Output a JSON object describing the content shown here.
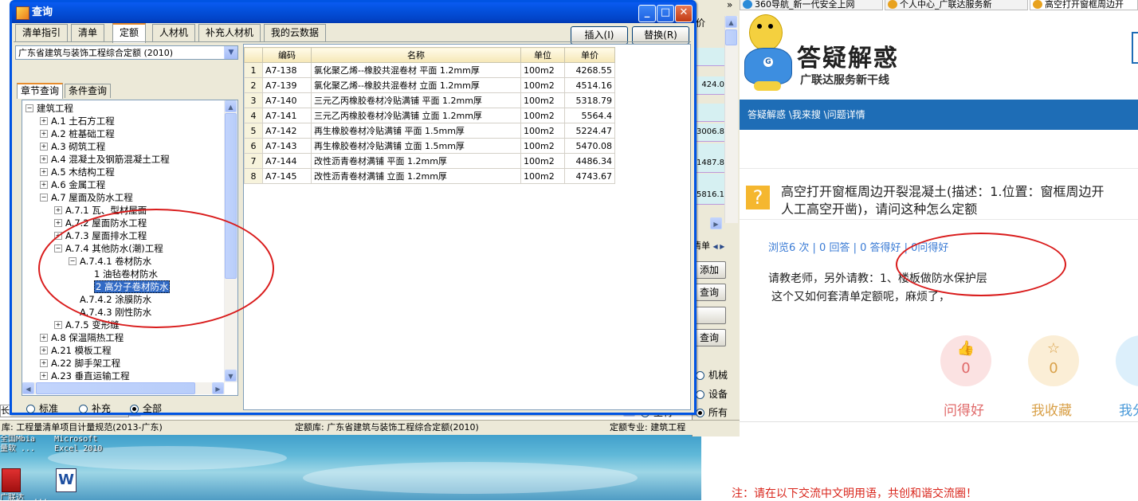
{
  "dialog": {
    "title": "查询",
    "tabs": [
      "清单指引",
      "清单",
      "定额",
      "人材机",
      "补充人材机",
      "我的云数据"
    ],
    "selected_tab": "定额",
    "insert_button": "插入(I)",
    "replace_button": "替换(R)",
    "library_combo": "广东省建筑与装饰工程综合定额 (2010)",
    "subtabs": [
      "章节查询",
      "条件查询"
    ],
    "tree": [
      {
        "label": "建筑工程",
        "pm": "−",
        "indent": 0
      },
      {
        "label": "A.1 土石方工程",
        "pm": "+",
        "indent": 1
      },
      {
        "label": "A.2 桩基础工程",
        "pm": "+",
        "indent": 1
      },
      {
        "label": "A.3 砌筑工程",
        "pm": "+",
        "indent": 1
      },
      {
        "label": "A.4 混凝土及钢筋混凝土工程",
        "pm": "+",
        "indent": 1
      },
      {
        "label": "A.5 木结构工程",
        "pm": "+",
        "indent": 1
      },
      {
        "label": "A.6 金属工程",
        "pm": "+",
        "indent": 1
      },
      {
        "label": "A.7 屋面及防水工程",
        "pm": "−",
        "indent": 1
      },
      {
        "label": "A.7.1 瓦、型材屋面",
        "pm": "+",
        "indent": 2
      },
      {
        "label": "A.7.2 屋面防水工程",
        "pm": "+",
        "indent": 2
      },
      {
        "label": "A.7.3 屋面排水工程",
        "pm": "+",
        "indent": 2
      },
      {
        "label": "A.7.4 其他防水(潮)工程",
        "pm": "−",
        "indent": 2
      },
      {
        "label": "A.7.4.1 卷材防水",
        "pm": "−",
        "indent": 3
      },
      {
        "label": "1 油毡卷材防水",
        "pm": "",
        "indent": 4
      },
      {
        "label": "2 高分子卷材防水",
        "pm": "",
        "indent": 4,
        "selected": true
      },
      {
        "label": "A.7.4.2 涂膜防水",
        "pm": "",
        "indent": 3
      },
      {
        "label": "A.7.4.3 刚性防水",
        "pm": "",
        "indent": 3
      },
      {
        "label": "A.7.5 变形缝",
        "pm": "+",
        "indent": 2
      },
      {
        "label": "A.8 保温隔热工程",
        "pm": "+",
        "indent": 1
      },
      {
        "label": "A.21 模板工程",
        "pm": "+",
        "indent": 1
      },
      {
        "label": "A.22 脚手架工程",
        "pm": "+",
        "indent": 1
      },
      {
        "label": "A.23 垂直运输工程",
        "pm": "+",
        "indent": 1
      }
    ],
    "radios": [
      {
        "label": "标准",
        "checked": false
      },
      {
        "label": "补充",
        "checked": false
      },
      {
        "label": "全部",
        "checked": true
      }
    ],
    "table": {
      "headers": [
        "编码",
        "名称",
        "单位",
        "单价"
      ],
      "rows": [
        {
          "n": "1",
          "code": "A7-138",
          "name": "氯化聚乙烯--橡胶共混卷材 平面 1.2mm厚",
          "unit": "100m2",
          "price": "4268.55"
        },
        {
          "n": "2",
          "code": "A7-139",
          "name": "氯化聚乙烯--橡胶共混卷材 立面 1.2mm厚",
          "unit": "100m2",
          "price": "4514.16"
        },
        {
          "n": "3",
          "code": "A7-140",
          "name": "三元乙丙橡胶卷材冷贴满铺 平面 1.2mm厚",
          "unit": "100m2",
          "price": "5318.79"
        },
        {
          "n": "4",
          "code": "A7-141",
          "name": "三元乙丙橡胶卷材冷贴满铺 立面 1.2mm厚",
          "unit": "100m2",
          "price": "5564.4"
        },
        {
          "n": "5",
          "code": "A7-142",
          "name": "再生橡胶卷材冷贴满铺 平面 1.5mm厚",
          "unit": "100m2",
          "price": "5224.47"
        },
        {
          "n": "6",
          "code": "A7-143",
          "name": "再生橡胶卷材冷贴满铺 立面 1.5mm厚",
          "unit": "100m2",
          "price": "5470.08"
        },
        {
          "n": "7",
          "code": "A7-144",
          "name": "改性沥青卷材满铺 平面 1.2mm厚",
          "unit": "100m2",
          "price": "4486.34"
        },
        {
          "n": "8",
          "code": "A7-145",
          "name": "改性沥青卷材满铺 立面 1.2mm厚",
          "unit": "100m2",
          "price": "4743.67"
        }
      ]
    }
  },
  "background_app": {
    "col_header": "价",
    "values": [
      "424.0",
      "3006.8",
      "1487.8",
      "5816.1"
    ],
    "panel_label": "清单",
    "add_button": "添加",
    "query_button_1": "查询",
    "query_button_2": "查询",
    "radio_machine": "机械",
    "radio_equipment": "设备",
    "radio_all": "所有",
    "radio_main": "主材",
    "left_fragment": "长城大(万台网)"
  },
  "status_bar": {
    "left": "库: 工程量清单项目计量规范(2013-广东)",
    "middle": "定额库: 广东省建筑与装饰工程综合定额(2010)",
    "right": "定额专业: 建筑工程"
  },
  "desktop": {
    "icon_label_top": "全国Mbia    Microsoft\n量软 ...    Excel 2010",
    "icon_label_bottom": "广联达  ..."
  },
  "browser": {
    "tabs": [
      "360导航_新一代安全上网",
      "个人中心_广联达服务新",
      "高空打开窗框周边开"
    ],
    "menu_arrows": "»",
    "logo_title": "答疑解惑",
    "logo_subtitle": "广联达服务新干线",
    "breadcrumb": "答疑解惑 \\我来搜 \\问题详情",
    "question_icon": "?",
    "question_title_1": "高空打开窗框周边开裂混凝土(描述：1.位置：窗框周边开",
    "question_title_2": "人工高空开凿)，请问这种怎么定额",
    "stats": "浏览6 次 | 0 回答 | 0 答得好 | 0问得好",
    "body_line_1": "请教老师，另外请教：1、楼板做防水保护层",
    "body_line_2": "这个又如何套清单定额呢，麻烦了，",
    "actions": [
      {
        "label": "问得好",
        "count": "0",
        "icon": "thumb-up-icon",
        "glyph": "👍",
        "bg": "#fbe2e2",
        "fg": "#e06a6a"
      },
      {
        "label": "我收藏",
        "count": "0",
        "icon": "star-icon",
        "glyph": "☆",
        "bg": "#fbeed6",
        "fg": "#d9a14a"
      },
      {
        "label": "我分",
        "count": "",
        "icon": "share-icon",
        "glyph": "",
        "bg": "#dceffb",
        "fg": "#4a9ad9"
      }
    ],
    "notice": "注：请在以下交流中文明用语，共创和谐交流圈！"
  },
  "colors": {
    "xp_title": "#0054e3",
    "annotation_red": "#d91b1b",
    "nav_blue": "#1e6db6",
    "selection": "#316ac5"
  }
}
